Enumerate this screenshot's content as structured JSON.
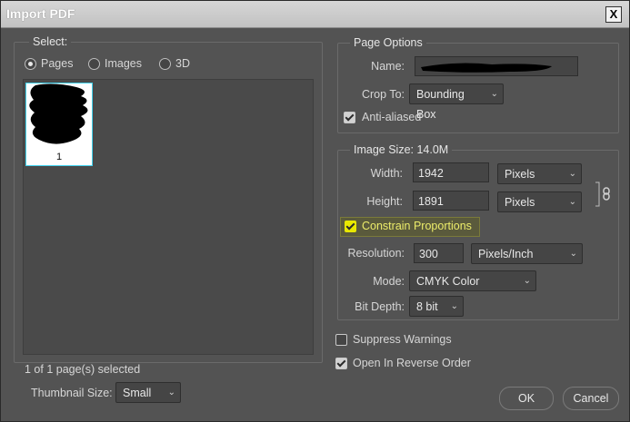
{
  "window": {
    "title": "Import PDF",
    "close_label": "X"
  },
  "select_panel": {
    "legend": "Select:",
    "options": [
      {
        "label": "Pages",
        "selected": true
      },
      {
        "label": "Images",
        "selected": false
      },
      {
        "label": "3D",
        "selected": false
      }
    ],
    "thumbnail_page_number": "1",
    "selection_status": "1 of 1 page(s) selected",
    "thumbnail_size_label": "Thumbnail Size:",
    "thumbnail_size_value": "Small"
  },
  "page_options": {
    "legend": "Page Options",
    "name_label": "Name:",
    "crop_to_label": "Crop To:",
    "crop_to_value": "Bounding Box",
    "anti_aliased_label": "Anti-aliased",
    "anti_aliased_checked": true
  },
  "image_size": {
    "legend": "Image Size: 14.0M",
    "width_label": "Width:",
    "width_value": "1942",
    "width_unit": "Pixels",
    "height_label": "Height:",
    "height_value": "1891",
    "height_unit": "Pixels",
    "constrain_label": "Constrain Proportions",
    "constrain_checked": true,
    "resolution_label": "Resolution:",
    "resolution_value": "300",
    "resolution_unit": "Pixels/Inch",
    "mode_label": "Mode:",
    "mode_value": "CMYK Color",
    "bit_depth_label": "Bit Depth:",
    "bit_depth_value": "8 bit"
  },
  "options": {
    "suppress_warnings_label": "Suppress Warnings",
    "suppress_warnings_checked": false,
    "reverse_order_label": "Open In Reverse Order",
    "reverse_order_checked": true
  },
  "buttons": {
    "ok": "OK",
    "cancel": "Cancel"
  },
  "icons": {
    "chevron": "chevron-down-icon",
    "link": "link-chain-icon"
  },
  "colors": {
    "thumbnail_border": "#44d4f0",
    "highlight": "#e8e800"
  }
}
